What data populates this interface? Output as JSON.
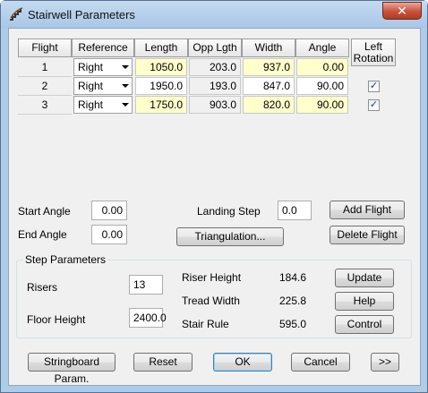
{
  "window": {
    "title": "Stairwell Parameters",
    "close_glyph": "✕"
  },
  "table": {
    "headers": {
      "flight": "Flight",
      "reference": "Reference",
      "length": "Length",
      "opp_lgth": "Opp Lgth",
      "width": "Width",
      "angle": "Angle",
      "left_rotation_1": "Left",
      "left_rotation_2": "Rotation"
    },
    "rows": [
      {
        "flight": "1",
        "reference": "Right",
        "length": "1050.0",
        "opp_lgth": "203.0",
        "width": "937.0",
        "angle": "0.00",
        "left_rotation": null
      },
      {
        "flight": "2",
        "reference": "Right",
        "length": "1950.0",
        "opp_lgth": "193.0",
        "width": "847.0",
        "angle": "90.00",
        "left_rotation": true
      },
      {
        "flight": "3",
        "reference": "Right",
        "length": "1750.0",
        "opp_lgth": "903.0",
        "width": "820.0",
        "angle": "90.00",
        "left_rotation": true
      }
    ]
  },
  "controls": {
    "start_angle_label": "Start Angle",
    "start_angle": "0.00",
    "end_angle_label": "End Angle",
    "end_angle": "0.00",
    "landing_step_label": "Landing Step",
    "landing_step": "0.0",
    "add_flight": "Add Flight",
    "triangulation": "Triangulation...",
    "delete_flight": "Delete Flight"
  },
  "step_parameters": {
    "title": "Step Parameters",
    "risers_label": "Risers",
    "risers": "13",
    "floor_height_label": "Floor Height",
    "floor_height": "2400.0",
    "riser_height_label": "Riser Height",
    "riser_height": "184.6",
    "tread_width_label": "Tread Width",
    "tread_width": "225.8",
    "stair_rule_label": "Stair Rule",
    "stair_rule": "595.0",
    "update": "Update",
    "help": "Help",
    "control": "Control"
  },
  "footer": {
    "stringboard": "Stringboard Param.",
    "reset": "Reset",
    "ok": "OK",
    "cancel": "Cancel",
    "more": ">>"
  }
}
